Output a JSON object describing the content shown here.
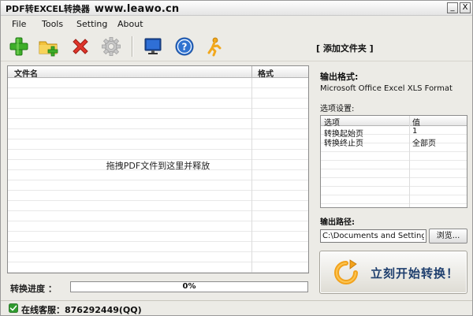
{
  "window": {
    "title_app": "PDF转EXCEL转换器",
    "title_url": "www.leawo.cn",
    "min_glyph": "_",
    "close_glyph": "X"
  },
  "menu": [
    "File",
    "Tools",
    "Setting",
    "About"
  ],
  "toolbar": {
    "icons": [
      "add-icon",
      "add-folder-icon",
      "delete-icon",
      "settings-icon",
      "monitor-icon",
      "help-icon",
      "support-person-icon"
    ],
    "add_folder_link": "[ 添加文件夹 ]"
  },
  "file_list": {
    "col_filename": "文件名",
    "col_format": "格式",
    "drop_hint": "拖拽PDF文件到这里并释放"
  },
  "progress": {
    "label": "转换进度 ：",
    "value_text": "0%",
    "fraction": 0
  },
  "output_format": {
    "label": "输出格式:",
    "value": "Microsoft Office Excel XLS Format"
  },
  "options": {
    "label": "选项设置:",
    "col_option": "选项",
    "col_value": "值",
    "rows": [
      {
        "option": "转换起始页",
        "value": "1"
      },
      {
        "option": "转换终止页",
        "value": "全部页"
      }
    ]
  },
  "output_path": {
    "label": "输出路径:",
    "value": "C:\\Documents and Settings\\",
    "browse_label": "浏览..."
  },
  "start_button": {
    "label": "立刻开始转换！"
  },
  "status": {
    "text": "在线客服：876292449(QQ)"
  },
  "colors": {
    "accent": "#1f3f6e",
    "progress": "#3a7bd5",
    "status_ok": "#2e9a2e"
  }
}
